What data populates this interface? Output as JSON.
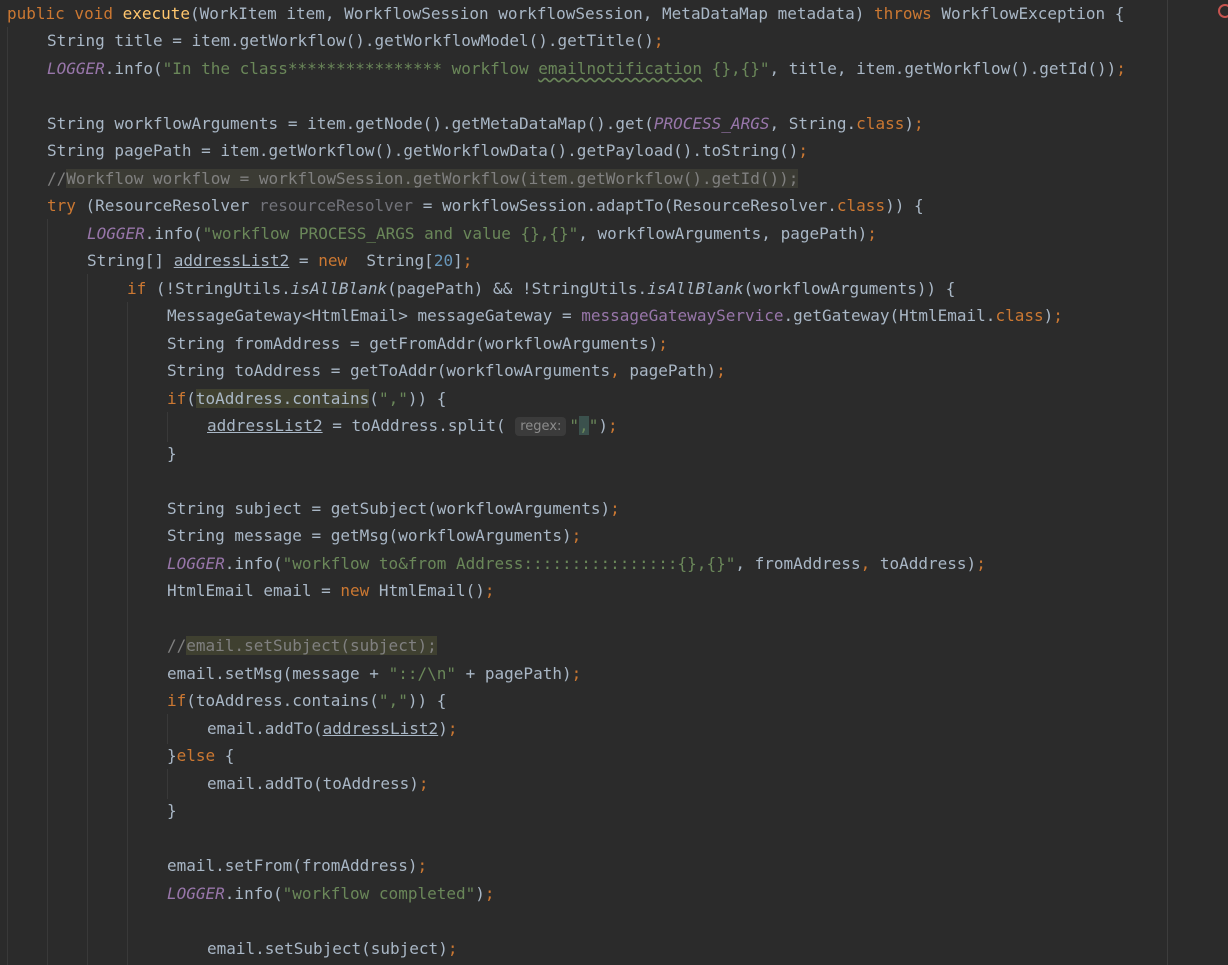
{
  "editor": {
    "language": "Java",
    "gutter_marker": "error-indicator-icon",
    "colors": {
      "background": "#2b2b2b",
      "default_text": "#a9b7c6",
      "keyword": "#cc7832",
      "method_decl": "#ffc66d",
      "string": "#6a8759",
      "static_field": "#9876aa",
      "number": "#6897bb",
      "comment": "#808080"
    }
  },
  "code": {
    "l1": {
      "kw1": "public void ",
      "name": "execute",
      "params": "(WorkItem item, WorkflowSession workflowSession, MetaDataMap metadata) ",
      "throws": "throws",
      "exc": " WorkflowException {"
    },
    "l2": {
      "a": "String title = item.getWorkflow().getWorkflowModel().getTitle()",
      "semi": ";"
    },
    "l3": {
      "logger": "LOGGER",
      "a": ".info(",
      "s1": "\"In the class**************** workflow ",
      "s2": "emailnotification",
      "s3": " {},{}\"",
      "b": ", title, item.getWorkflow().getId())",
      "semi": ";"
    },
    "l5": {
      "a": "String workflowArguments = item.getNode().getMetaDataMap().get(",
      "c": "PROCESS_ARGS",
      "d": ", String.",
      "e": "class",
      "f": ")",
      "semi": ";"
    },
    "l6": {
      "a": "String pagePath = item.getWorkflow().getWorkflowData().getPayload().toString()",
      "semi": ";"
    },
    "l7": {
      "a": "//",
      "b": "Workflow workflow = workflowSession.getWorkflow(item.getWorkflow().getId());"
    },
    "l8": {
      "kw": "try",
      "a": " (ResourceResolver ",
      "b": "resourceResolver",
      "c": " = workflowSession.adaptTo(ResourceResolver.",
      "d": "class",
      "e": ")) {"
    },
    "l9": {
      "logger": "LOGGER",
      "a": ".info(",
      "s": "\"workflow PROCESS_ARGS and value {},{}\"",
      "b": ", workflowArguments, pagePath)",
      "semi": ";"
    },
    "l10": {
      "a": "String[] ",
      "b": "addressList2",
      "c": " = ",
      "kw": "new",
      "d": "  String[",
      "n": "20",
      "e": "]",
      "semi": ";"
    },
    "l11": {
      "kw": "if",
      "a": " (!StringUtils.",
      "b": "isAllBlank",
      "c": "(pagePath) && !StringUtils.",
      "d": "isAllBlank",
      "e": "(workflowArguments)) {"
    },
    "l12": {
      "a": "MessageGateway<HtmlEmail> messageGateway = ",
      "b": "messageGatewayService",
      "c": ".getGateway(HtmlEmail.",
      "d": "class",
      "e": ")",
      "semi": ";"
    },
    "l13": {
      "a": "String fromAddress = getFromAddr(workflowArguments)",
      "semi": ";"
    },
    "l14": {
      "a": "String toAddress = getToAddr(workflowArguments",
      "comma": ",",
      "b": " pagePath)",
      "semi": ";"
    },
    "l15": {
      "kw": "if",
      "a": "(",
      "b": "toAddress.contains",
      "c": "(",
      "s": "\",\"",
      "d": ")) {"
    },
    "l16": {
      "a": "addressList2",
      "b": " = toAddress.split( ",
      "hint": "regex:",
      "s1": "\"",
      "s2": ",",
      "s3": "\"",
      "c": ")",
      "semi": ";"
    },
    "l17": {
      "a": "}"
    },
    "l19": {
      "a": "String subject = getSubject(workflowArguments)",
      "semi": ";"
    },
    "l20": {
      "a": "String message = getMsg(workflowArguments)",
      "semi": ";"
    },
    "l21": {
      "logger": "LOGGER",
      "a": ".info(",
      "s": "\"workflow to&from Address::::::::::::::::{},{}\"",
      "b": ", fromAddress",
      "comma": ",",
      "c": " toAddress)",
      "semi": ";"
    },
    "l22": {
      "a": "HtmlEmail email = ",
      "kw": "new",
      "b": " HtmlEmail()",
      "semi": ";"
    },
    "l24": {
      "a": "//",
      "b": "email.setSubject(subject);"
    },
    "l25": {
      "a": "email.setMsg(message + ",
      "s": "\"::/\\n\"",
      "b": " + pagePath)",
      "semi": ";"
    },
    "l26": {
      "kw": "if",
      "a": "(toAddress.contains(",
      "s": "\",\"",
      "b": ")) {"
    },
    "l27": {
      "a": "email.addTo(",
      "b": "addressList2",
      "c": ")",
      "semi": ";"
    },
    "l28": {
      "a": "}",
      "kw": "else",
      "b": " {"
    },
    "l29": {
      "a": "email.addTo(toAddress)",
      "semi": ";"
    },
    "l30": {
      "a": "}"
    },
    "l32": {
      "a": "email.setFrom(fromAddress)",
      "semi": ";"
    },
    "l33": {
      "logger": "LOGGER",
      "a": ".info(",
      "s": "\"workflow completed\"",
      "b": ")",
      "semi": ";"
    },
    "l35": {
      "a": "email.setSubject(subject)",
      "semi": ";"
    }
  }
}
